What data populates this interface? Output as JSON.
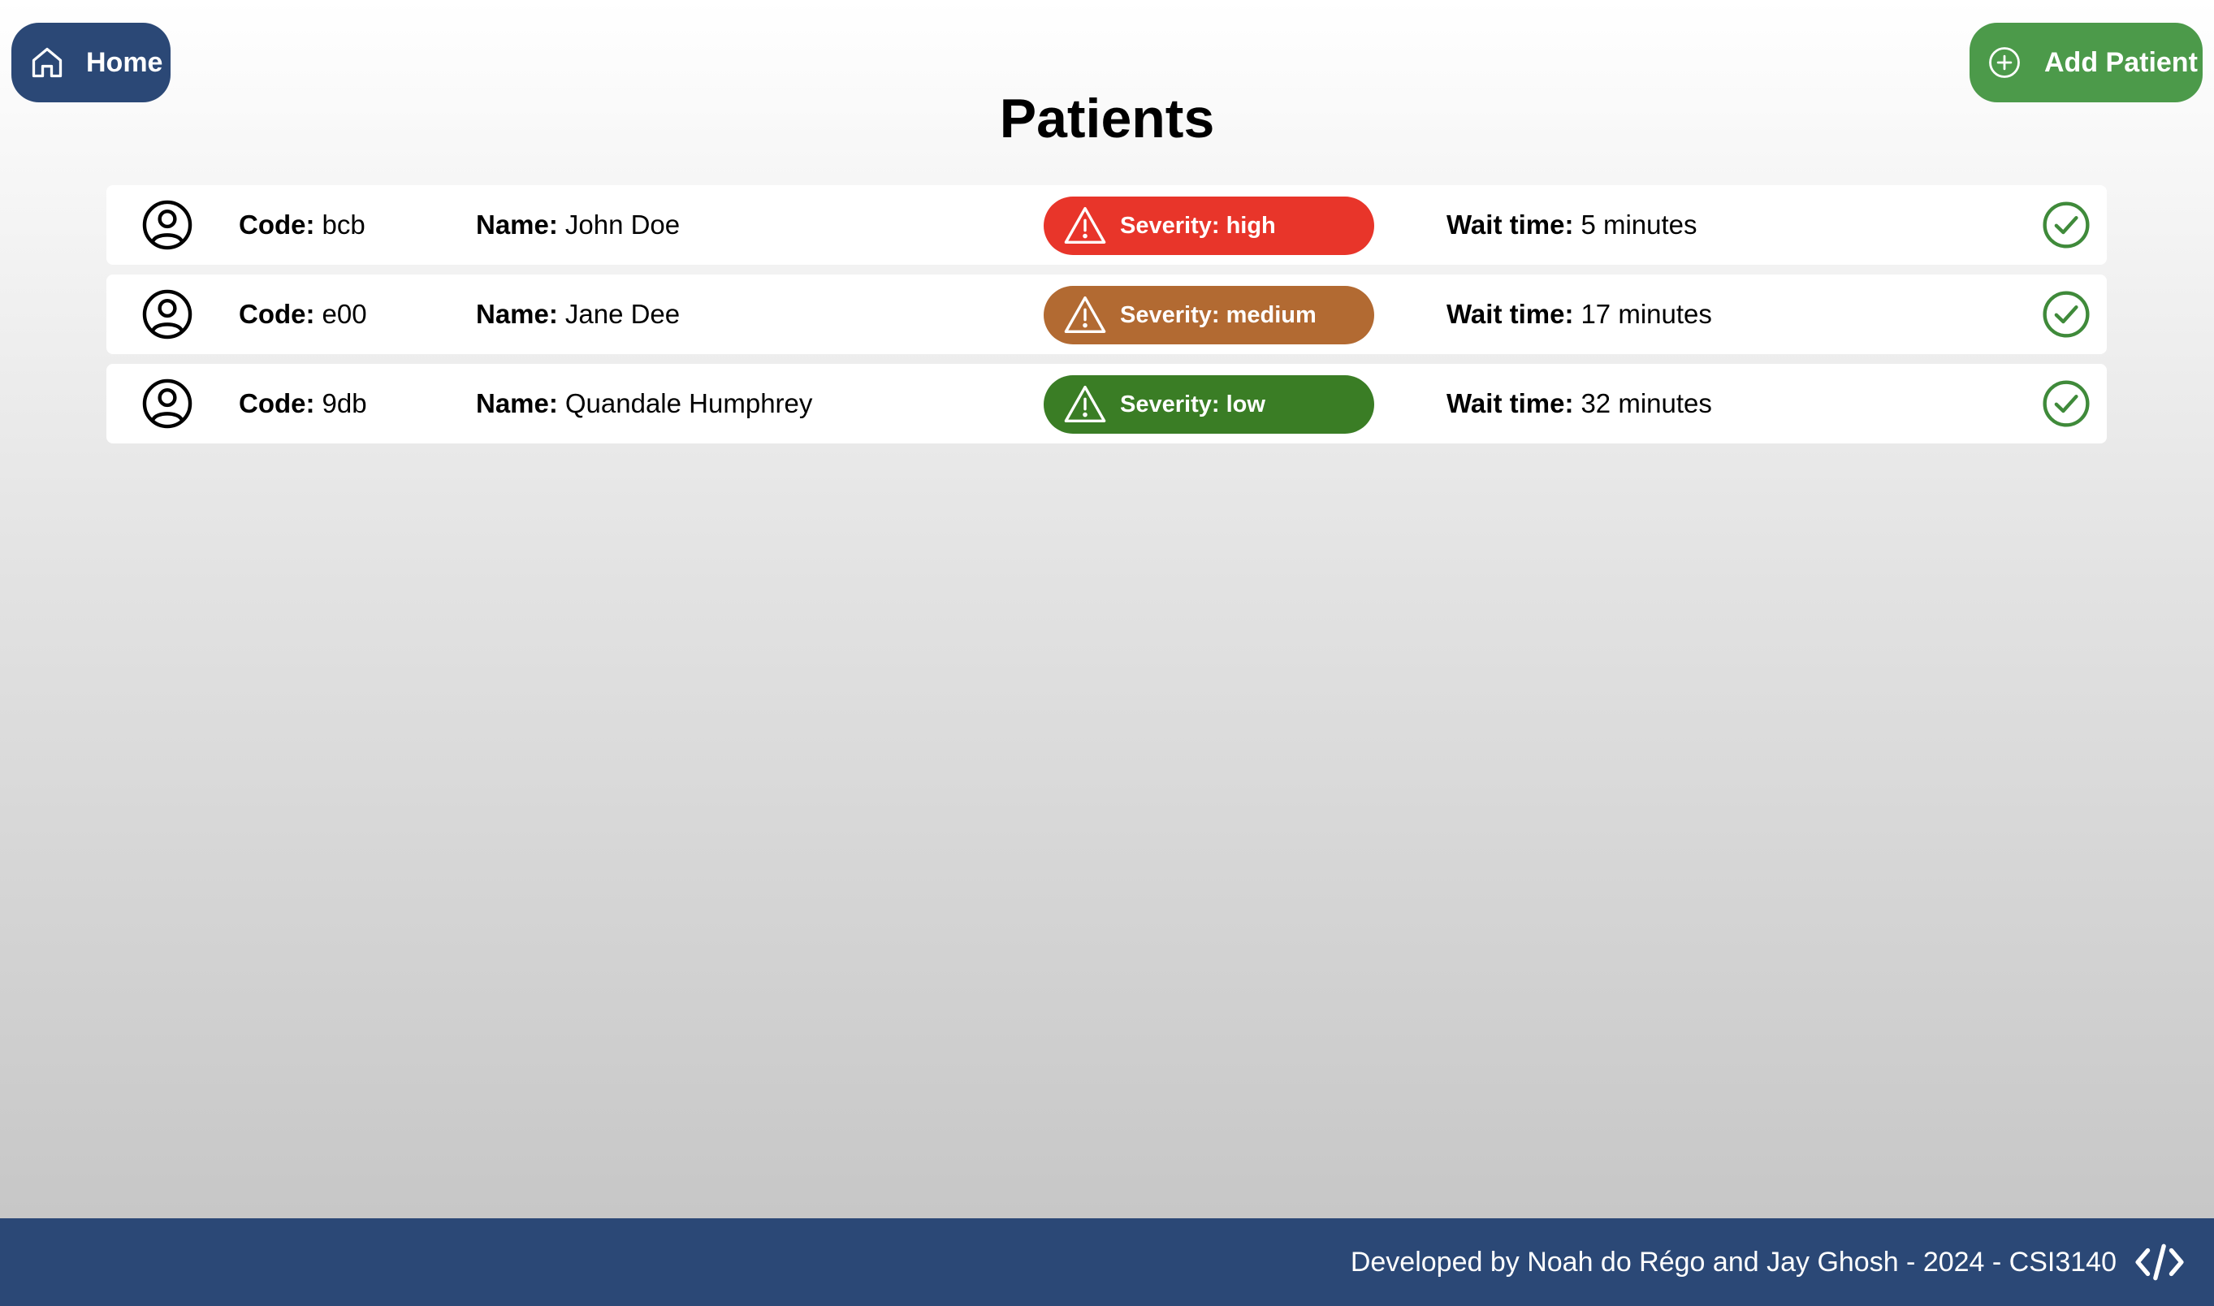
{
  "header": {
    "home_label": "Home",
    "add_label": "Add Patient",
    "title": "Patients",
    "home_color": "#2b4876",
    "add_color": "#4c9a4a"
  },
  "labels": {
    "code": "Code:",
    "name": "Name:",
    "wait": "Wait time:"
  },
  "patients": [
    {
      "code": "bcb",
      "name": "John Doe",
      "severity": "Severity: high",
      "severity_color": "#e8352a",
      "wait": "5 minutes"
    },
    {
      "code": "e00",
      "name": "Jane Dee",
      "severity": "Severity: medium",
      "severity_color": "#b26a32",
      "wait": "17 minutes"
    },
    {
      "code": "9db",
      "name": "Quandale Humphrey",
      "severity": "Severity: low",
      "severity_color": "#3a7d25",
      "wait": "32 minutes"
    }
  ],
  "icons": {
    "home": "home-icon",
    "add": "plus-circle-icon",
    "avatar": "user-circle-icon",
    "warning": "warning-triangle-icon",
    "check": "check-circle-icon",
    "code": "code-icon"
  },
  "footer": {
    "text": "Developed by Noah do Régo and Jay Ghosh - 2024 - CSI3140",
    "color": "#2b4876"
  }
}
